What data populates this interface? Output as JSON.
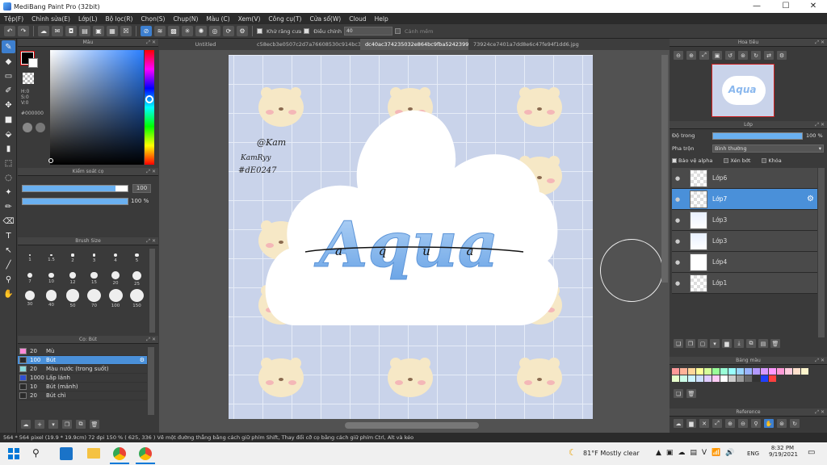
{
  "window": {
    "title": "MediBang Paint Pro (32bit)",
    "min": "—",
    "max": "☐",
    "close": "✕"
  },
  "menu": [
    "Tệp(F)",
    "Chỉnh sửa(E)",
    "Lớp(L)",
    "Bộ lọc(R)",
    "Chọn(S)",
    "Chụp(N)",
    "Màu (C)",
    "Xem(V)",
    "Công cụ(T)",
    "Cửa sổ(W)",
    "Cloud",
    "Help"
  ],
  "toolbar": {
    "anti_alias": "Khử răng cưa",
    "correction_label": "Điều chỉnh",
    "correction_value": "40",
    "hand_label": "Cảnh mềm"
  },
  "panels": {
    "color": "Màu",
    "palette_check": "Kiểm soát cọ",
    "brush_size": "Brush Size",
    "brush": "Cọ: Bút",
    "navigator": "Hoa tiêu",
    "layer": "Lớp",
    "swatch": "Bảng màu",
    "reference": "Reference"
  },
  "color": {
    "h": "H:0",
    "s": "S:0",
    "v": "V:0",
    "hex": "#000000",
    "primary": "#000000"
  },
  "brush_control": {
    "size": "100",
    "opacity": "100 %"
  },
  "brush_sizes": [
    "1",
    "1.5",
    "2",
    "3",
    "4",
    "5",
    "7",
    "10",
    "12",
    "15",
    "20",
    "25",
    "30",
    "40",
    "50",
    "70",
    "100",
    "150"
  ],
  "brushes": [
    {
      "value": "20",
      "name": "Mù",
      "color": "#ff8ad8"
    },
    {
      "value": "100",
      "name": "Bút",
      "color": "#2a2a2a",
      "selected": true
    },
    {
      "value": "20",
      "name": "Màu nước (trong suốt)",
      "color": "#8ad8d8"
    },
    {
      "value": "1000",
      "name": "Lấp lánh",
      "color": "#3050d0"
    },
    {
      "value": "10",
      "name": "Bút (mảnh)",
      "color": "#2a2a2a"
    },
    {
      "value": "20",
      "name": "Bút chì",
      "color": "#2a2a2a"
    }
  ],
  "tabs": [
    "Untitled",
    "c58ecb3e0507c2d7a76608530c914bc3.jpg",
    "dc40ac374235032e864bc9fba5242399.jpg",
    "73924ce7401a7dd8e6c47fe94f1dd6.jpg"
  ],
  "artwork": {
    "handle": "@Kam",
    "name": "KamRyy",
    "code": "#dE0247",
    "title": "Aqua",
    "subtitle": "a q u a"
  },
  "layers": {
    "opacity_label": "Độ trong",
    "opacity_value": "100 %",
    "blend_label": "Pha trộn",
    "blend_value": "Bình thường",
    "protect_alpha": "Bảo vệ alpha",
    "clipping": "Xén bớt",
    "lock": "Khóa",
    "items": [
      {
        "name": "Lớp6",
        "thumb": "chk",
        "selected": false
      },
      {
        "name": "Lớp7",
        "thumb": "chk",
        "selected": true
      },
      {
        "name": "Lớp3",
        "thumb": "img",
        "selected": false
      },
      {
        "name": "Lớp3",
        "thumb": "img",
        "selected": false
      },
      {
        "name": "Lớp4",
        "thumb": "white",
        "selected": false
      },
      {
        "name": "Lớp1",
        "thumb": "chk",
        "selected": false
      }
    ]
  },
  "swatches": [
    "#ff9999",
    "#ffb399",
    "#ffd699",
    "#ffff99",
    "#d6ff99",
    "#99ff99",
    "#99ffd6",
    "#99ffff",
    "#99d6ff",
    "#99b3ff",
    "#b399ff",
    "#d699ff",
    "#ff99ff",
    "#ff99d6",
    "#ffccdd",
    "#ffe0cc",
    "#fff5cc",
    "#e8ffcc",
    "#ccffe8",
    "#ccf5ff",
    "#cce0ff",
    "#e0ccff",
    "#ffccf5",
    "#ffffff",
    "#cccccc",
    "#999999",
    "#666666",
    "#333333",
    "#2040ff",
    "#ff4040"
  ],
  "status": "564 * 564 pixel  (19.9 * 19.9cm)  72 dpi  150 %  ( 625, 336 )  Vẽ một đường thẳng bằng cách giữ phím Shift, Thay đổi cỡ cọ bằng cách giữ phím Ctrl, Alt và kéo",
  "taskbar": {
    "weather": "81°F  Mostly clear",
    "lang": "ENG",
    "time": "8:32 PM",
    "date": "9/19/2021"
  }
}
